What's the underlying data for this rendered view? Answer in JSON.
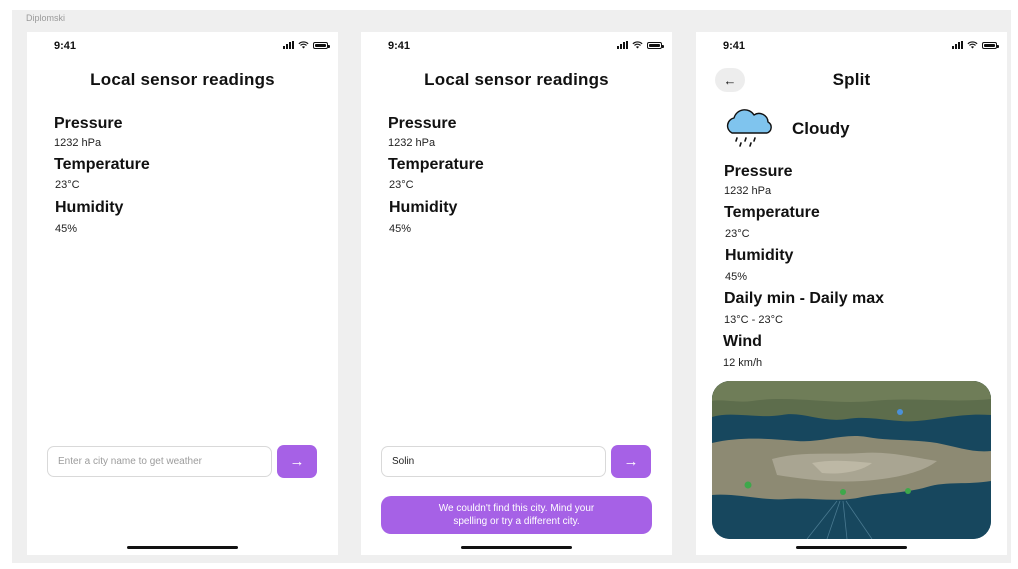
{
  "frame_label": "Diplomski",
  "status_time": "9:41",
  "arrow_label": "→",
  "back_label": "←",
  "screens": [
    {
      "title": "Local sensor readings",
      "readings": [
        {
          "label": "Pressure",
          "value": "1232 hPa"
        },
        {
          "label": "Temperature",
          "value": "23°C"
        },
        {
          "label": "Humidity",
          "value": "45%"
        }
      ],
      "search": {
        "placeholder": "Enter a city name to get weather",
        "value": ""
      }
    },
    {
      "title": "Local sensor readings",
      "readings": [
        {
          "label": "Pressure",
          "value": "1232 hPa"
        },
        {
          "label": "Temperature",
          "value": "23°C"
        },
        {
          "label": "Humidity",
          "value": "45%"
        }
      ],
      "search": {
        "placeholder": "",
        "value": "Solin"
      },
      "error_line1": "We couldn't find this city. Mind your",
      "error_line2": "spelling or try a different city."
    },
    {
      "title": "Split",
      "condition": "Cloudy",
      "condition_icon": "rain-cloud-icon",
      "readings": [
        {
          "label": "Pressure",
          "value": "1232 hPa"
        },
        {
          "label": "Temperature",
          "value": "23°C"
        },
        {
          "label": "Humidity",
          "value": "45%"
        },
        {
          "label": "Daily min - Daily max",
          "value": "13°C - 23°C"
        },
        {
          "label": "Wind",
          "value": "12 km/h"
        }
      ],
      "map_icon": "satellite-map-image"
    }
  ],
  "colors": {
    "accent": "#a661e6",
    "background": "#efefef",
    "cloud": "#7fc4ee"
  }
}
